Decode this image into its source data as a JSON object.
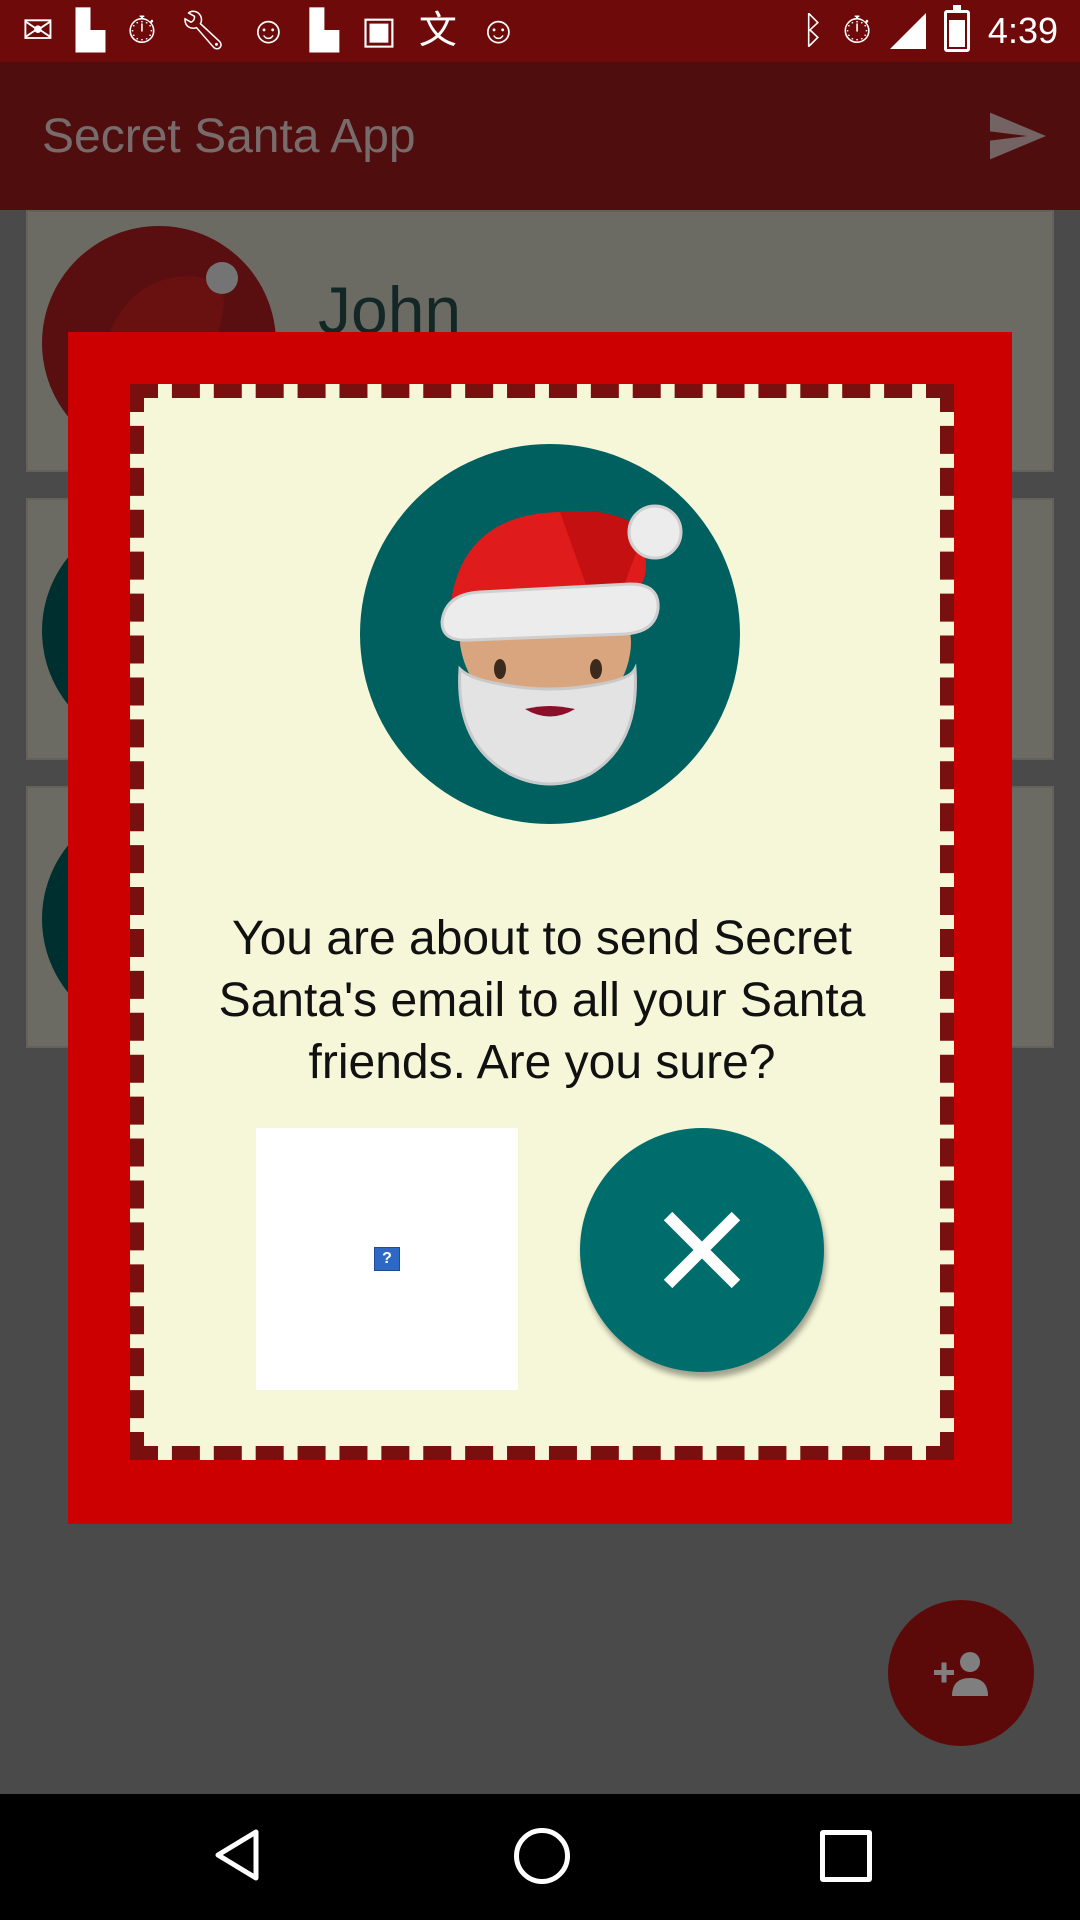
{
  "status_bar": {
    "time": "4:39",
    "icons": [
      "mail-icon",
      "flipboard-icon",
      "alarm-icon",
      "wrench-icon",
      "smiley-icon",
      "flipboard-icon",
      "qt-icon",
      "translate-icon",
      "smiley-icon",
      "bluetooth-icon",
      "alarm-icon",
      "signal-icon",
      "battery-icon"
    ]
  },
  "app": {
    "title": "Secret Santa App",
    "contacts": [
      {
        "name": "John"
      }
    ]
  },
  "dialog": {
    "message": "You are about to send Secret Santa's email to all your Santa friends. Are you sure?",
    "broken_image_glyph": "?"
  },
  "colors": {
    "dialog_border": "#cc0000",
    "dialog_background": "#f6f7d8",
    "teal": "#006d6d",
    "app_bar": "#a01a1a"
  }
}
